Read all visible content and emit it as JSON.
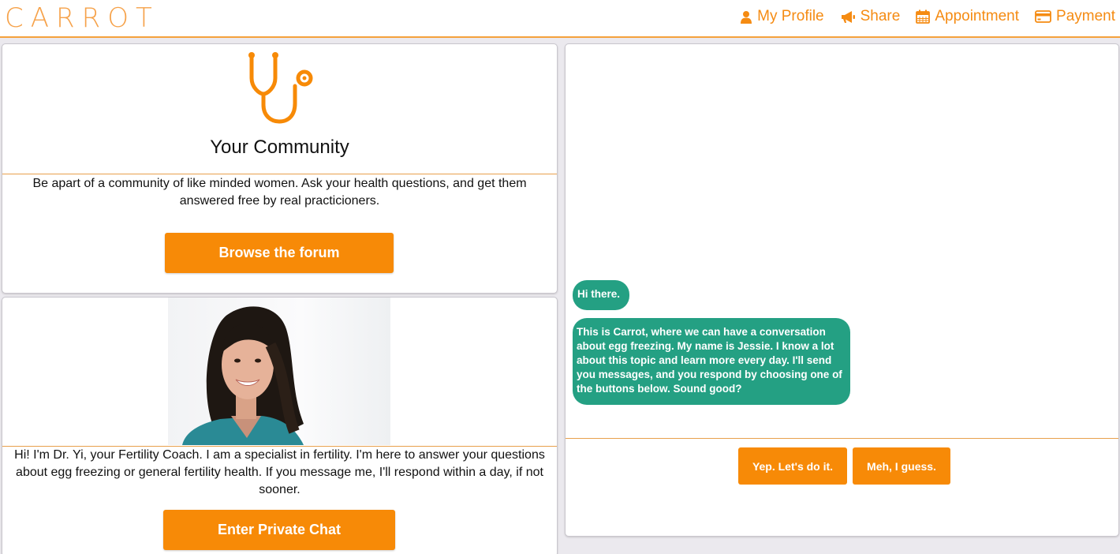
{
  "app": {
    "logo_text": "CARROT",
    "accent_color": "#f78a07",
    "chat_bubble_color": "#24a083"
  },
  "nav": {
    "items": [
      {
        "label": "My Profile",
        "icon": "user-icon"
      },
      {
        "label": "Share",
        "icon": "megaphone-icon"
      },
      {
        "label": "Appointment",
        "icon": "calendar-icon"
      },
      {
        "label": "Payment",
        "icon": "credit-card-icon"
      }
    ]
  },
  "community": {
    "icon": "stethoscope-icon",
    "title": "Your Community",
    "description": "Be apart of a community of like minded women. Ask your health questions, and get them answered free by real practicioners.",
    "button_label": "Browse the forum"
  },
  "coach": {
    "photo": "doctor-portrait",
    "description": "Hi! I'm Dr. Yi, your Fertility Coach. I am a specialist in fertility. I'm here to answer your questions about egg freezing or general fertility health. If you message me, I'll respond within a day, if not sooner.",
    "button_label": "Enter Private Chat"
  },
  "chat": {
    "messages": [
      {
        "text": "Hi there."
      },
      {
        "text": "This is Carrot, where we can have a conversation about egg freezing. My name is Jessie. I know a lot about this topic and learn more every day. I'll send you messages, and you respond by choosing one of the buttons below. Sound good?"
      }
    ],
    "choices": [
      {
        "label": "Yep. Let's do it."
      },
      {
        "label": "Meh, I guess."
      }
    ]
  }
}
